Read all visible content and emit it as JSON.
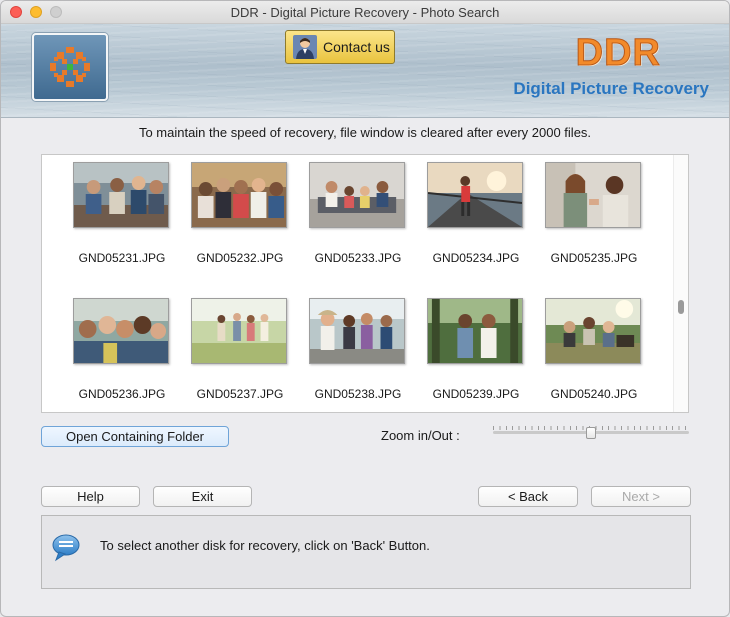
{
  "window": {
    "title": "DDR - Digital Picture Recovery - Photo Search"
  },
  "header": {
    "contact_label": "Contact us",
    "brand": "DDR",
    "subtitle": "Digital Picture Recovery",
    "colors": {
      "brand_orange": "#f28a2a",
      "subtitle_blue": "#2a76c0",
      "contact_gold": "#f3d15c"
    }
  },
  "notice": "To maintain the speed of recovery, file window is cleared after every 2000 files.",
  "gallery": {
    "files": [
      {
        "name": "GND05231.JPG",
        "icon": "photo-group-outdoor-table"
      },
      {
        "name": "GND05232.JPG",
        "icon": "photo-friends-group"
      },
      {
        "name": "GND05233.JPG",
        "icon": "photo-family-couch"
      },
      {
        "name": "GND05234.JPG",
        "icon": "photo-runner-bridge"
      },
      {
        "name": "GND05235.JPG",
        "icon": "photo-couple-talking"
      },
      {
        "name": "GND05236.JPG",
        "icon": "photo-selfie-group"
      },
      {
        "name": "GND05237.JPG",
        "icon": "photo-walking-field"
      },
      {
        "name": "GND05238.JPG",
        "icon": "photo-friends-walking"
      },
      {
        "name": "GND05239.JPG",
        "icon": "photo-women-park"
      },
      {
        "name": "GND05240.JPG",
        "icon": "photo-picnic-group"
      }
    ]
  },
  "controls": {
    "open_folder_label": "Open Containing Folder",
    "zoom_label": "Zoom in/Out :",
    "zoom_level": 0.5
  },
  "nav": {
    "help_label": "Help",
    "exit_label": "Exit",
    "back_label": "< Back",
    "next_label": "Next >"
  },
  "hint": {
    "icon": "speech-bubble-icon",
    "text": "To select another disk for recovery, click on 'Back' Button."
  }
}
